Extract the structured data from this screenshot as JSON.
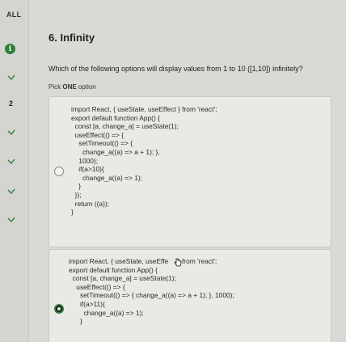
{
  "rail": {
    "all_label": "ALL",
    "info_icon": "info-circle-icon",
    "question_number": "2",
    "check_icon": "check-icon",
    "accent": "#2f7d3a"
  },
  "question": {
    "title": "6. Infinity",
    "text": "Which of the following options will display values from 1 to 10 ([1,10]) infinitely?",
    "pick_prefix": "Pick ",
    "pick_bold": "ONE",
    "pick_suffix": " option"
  },
  "options": [
    {
      "selected": false,
      "lines": [
        "import React, { useState, useEffect } from 'react';",
        "export default function App() {",
        "  const [a, change_a] = useState(1);",
        "  useEffect(() => {",
        "    setTimeout(() => {",
        "      change_a((a) => a + 1); },",
        "    1000);",
        "    if(a>10){",
        "      change_a((a) => 1);",
        "    }",
        "  });",
        "  return ((a));",
        "}"
      ]
    },
    {
      "selected": true,
      "lines": [
        "import React, { useState, useEffe     } from 'react';",
        "export default function App() {",
        "  const [a, change_a] = useState(1);",
        "    useEffect(() => {",
        "      setTimeout(() => { change_a((a) => a + 1); }, 1000);",
        "      if(a>11){",
        "        change_a((a) => 1);",
        "      }"
      ]
    }
  ]
}
